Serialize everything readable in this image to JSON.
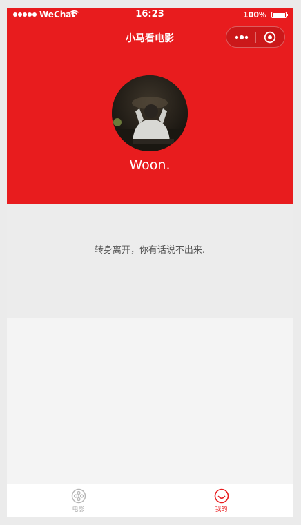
{
  "status_bar": {
    "carrier": "WeChat",
    "time": "16:23",
    "battery": "100%",
    "battery_level": 1.0
  },
  "nav": {
    "title": "小马看电影",
    "more_icon": "more-dots-icon",
    "close_icon": "close-target-icon"
  },
  "profile": {
    "username": "Woon.",
    "signature": "转身离开，你有话说不出来."
  },
  "tabbar": {
    "tabs": [
      {
        "label": "电影",
        "icon": "film-reel-icon",
        "active": false
      },
      {
        "label": "我的",
        "icon": "smiley-icon",
        "active": true
      }
    ]
  },
  "colors": {
    "brand_red": "#e81c1e",
    "inactive_gray": "#aaaaaa"
  }
}
